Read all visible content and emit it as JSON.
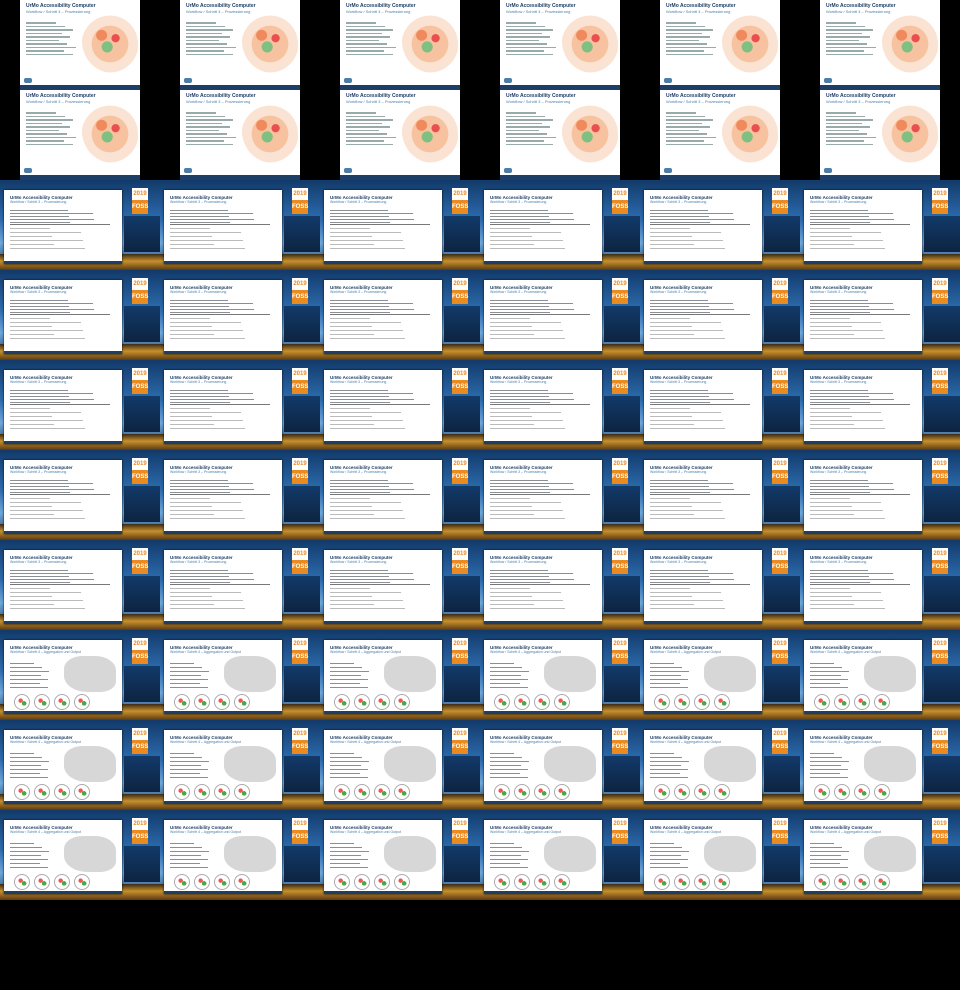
{
  "top_slide": {
    "title": "UrMo Accessibility Computer",
    "subtitle": "Workflow / Schritt 3 – Prozessierung"
  },
  "talk_slides": {
    "title": "UrMo Accessibility Computer",
    "subtitle_process": "Workflow / Schritt 3 – Prozessierung",
    "subtitle_aggregation": "Workflow / Schritt 4 – Aggregation und Output",
    "foss_year": "2019",
    "foss_label": "FOSS"
  },
  "grid": {
    "columns": 6,
    "rows": 9
  },
  "colors": {
    "slide_header": "#1d3e66",
    "foss_orange": "#e98b20",
    "stage_gold": "#c8902c"
  }
}
